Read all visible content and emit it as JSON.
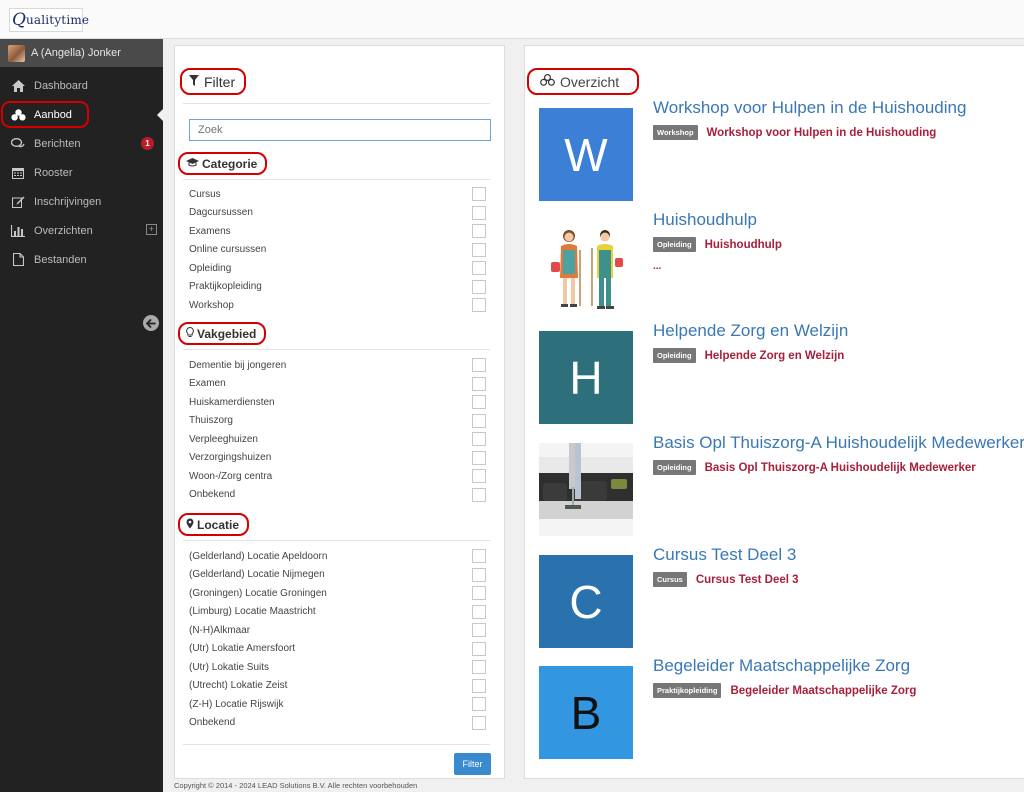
{
  "app": {
    "logo_q": "Q",
    "logo_text": "ualitytime"
  },
  "sidebar": {
    "user_name": "A (Angella) Jonker",
    "items": [
      {
        "label": "Dashboard",
        "icon": "home-icon"
      },
      {
        "label": "Aanbod",
        "icon": "cubes-icon",
        "active": true
      },
      {
        "label": "Berichten",
        "icon": "comments-icon",
        "badge": "1"
      },
      {
        "label": "Rooster",
        "icon": "calendar-icon"
      },
      {
        "label": "Inschrijvingen",
        "icon": "edit-icon"
      },
      {
        "label": "Overzichten",
        "icon": "bar-chart-icon",
        "expand": "⊞"
      },
      {
        "label": "Bestanden",
        "icon": "file-icon"
      }
    ],
    "collapse_icon": "arrow-circle-left-icon"
  },
  "filter": {
    "title": "Filter",
    "search_placeholder": "Zoek",
    "groups": {
      "categorie": {
        "title": "Categorie",
        "options": [
          "Cursus",
          "Dagcursussen",
          "Examens",
          "Online cursussen",
          "Opleiding",
          "Praktijkopleiding",
          "Workshop"
        ]
      },
      "vakgebied": {
        "title": "Vakgebied",
        "options": [
          "Dementie bij jongeren",
          "Examen",
          "Huiskamerdiensten",
          "Thuiszorg",
          "Verpleeghuizen",
          "Verzorgingshuizen",
          "Woon-/Zorg centra",
          "Onbekend"
        ]
      },
      "locatie": {
        "title": "Locatie",
        "options": [
          "(Gelderland) Locatie Apeldoorn",
          "(Gelderland) Locatie Nijmegen",
          "(Groningen) Locatie Groningen",
          "(Limburg) Locatie Maastricht",
          "(N-H)Alkmaar",
          "(Utr) Lokatie Amersfoort",
          "(Utr) Lokatie Suits",
          "(Utrecht) Lokatie Zeist",
          "(Z-H) Locatie Rijswijk",
          "Onbekend"
        ]
      }
    },
    "button_label": "Filter"
  },
  "overview": {
    "title": "Overzicht",
    "courses": [
      {
        "title": "Workshop voor Hulpen in de Huishouding",
        "type": "Workshop",
        "link": "Workshop voor Hulpen in de Huishouding",
        "thumb_letter": "W",
        "thumb_color": "#3b7fd6"
      },
      {
        "title": "Huishoudhulp",
        "type": "Opleiding",
        "link": "Huishoudhulp",
        "extra": "...",
        "thumb_image": "illustration-two-cleaners"
      },
      {
        "title": "Helpende Zorg en Welzijn",
        "type": "Opleiding",
        "link": "Helpende Zorg en Welzijn",
        "thumb_letter": "H",
        "thumb_color": "#2e6f7c"
      },
      {
        "title": "Basis Opl Thuiszorg-A Huishoudelijk Medewerker",
        "type": "Opleiding",
        "link": "Basis Opl Thuiszorg-A Huishoudelijk Medewerker",
        "thumb_image": "photo-vacuuming-sofa"
      },
      {
        "title": "Cursus Test Deel 3",
        "type": "Cursus",
        "link": "Cursus Test Deel 3",
        "thumb_letter": "C",
        "thumb_color": "#2a72ad"
      },
      {
        "title": "Begeleider Maatschappelijke Zorg",
        "type": "Praktijkopleiding",
        "link": "Begeleider Maatschappelijke Zorg",
        "thumb_letter": "B",
        "thumb_color": "#3396e0"
      }
    ]
  },
  "footer": "Copyright © 2014 - 2024 LEAD Solutions B.V. Alle rechten voorbehouden",
  "colors": {
    "sidebar_bg": "#222222",
    "highlight_ring": "#d40000",
    "link": "#a8203b",
    "title_blue": "#3a78b5",
    "badge": "#b91d2a",
    "button": "#3a8ad0"
  }
}
